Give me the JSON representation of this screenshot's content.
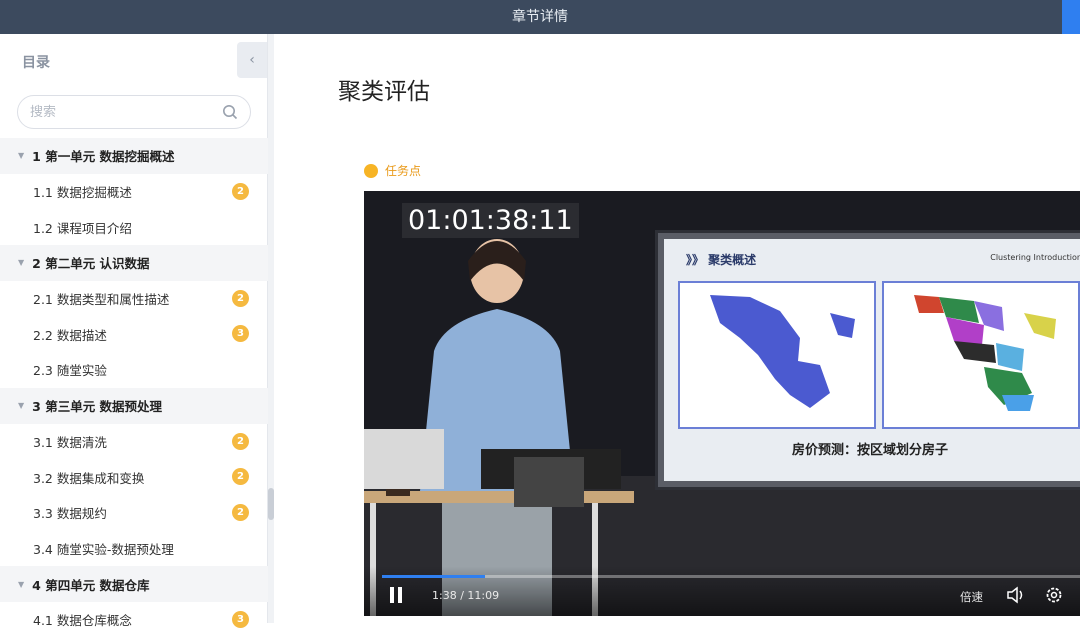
{
  "header": {
    "title": "章节详情"
  },
  "sidebar": {
    "heading": "目录",
    "collapse_icon": "chevron-left-icon",
    "search_placeholder": "搜索",
    "items": [
      {
        "type": "unit",
        "label": "1 第一单元 数据挖掘概述"
      },
      {
        "type": "lesson",
        "label": "1.1 数据挖掘概述",
        "badge": "2"
      },
      {
        "type": "lesson",
        "label": "1.2 课程项目介绍",
        "badge": ""
      },
      {
        "type": "unit",
        "label": "2 第二单元 认识数据"
      },
      {
        "type": "lesson",
        "label": "2.1 数据类型和属性描述",
        "badge": "2"
      },
      {
        "type": "lesson",
        "label": "2.2 数据描述",
        "badge": "3"
      },
      {
        "type": "lesson",
        "label": "2.3 随堂实验",
        "badge": ""
      },
      {
        "type": "unit",
        "label": "3 第三单元 数据预处理"
      },
      {
        "type": "lesson",
        "label": "3.1 数据清洗",
        "badge": "2"
      },
      {
        "type": "lesson",
        "label": "3.2 数据集成和变换",
        "badge": "2"
      },
      {
        "type": "lesson",
        "label": "3.3 数据规约",
        "badge": "2"
      },
      {
        "type": "lesson",
        "label": "3.4 随堂实验-数据预处理",
        "badge": ""
      },
      {
        "type": "unit",
        "label": "4 第四单元 数据仓库"
      },
      {
        "type": "lesson",
        "label": "4.1 数据仓库概念",
        "badge": "3"
      }
    ]
  },
  "main": {
    "title": "聚类评估",
    "task_label": "任务点",
    "video": {
      "timecode": "01:01:38:11",
      "slide_heading": "》》 聚类概述",
      "slide_heading_en": "Clustering Introduction",
      "slide_caption": "房价预测：按区域划分房子",
      "time": "1:38 / 11:09",
      "progress": 0.148,
      "speed_label": "倍速"
    }
  },
  "colors": {
    "accent": "#2f7ff0",
    "badge": "#f5b940",
    "task": "#f7b425",
    "topbar": "#3c4a5e"
  }
}
